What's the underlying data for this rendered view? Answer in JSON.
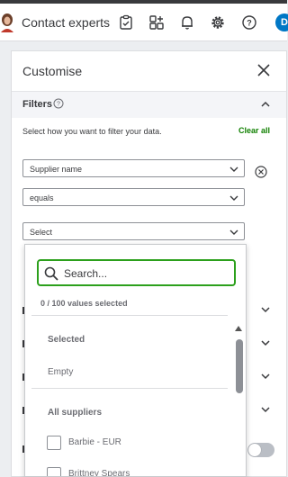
{
  "topbar": {
    "contact_label": "Contact experts",
    "avatar_initial": "D",
    "icons": [
      "user-avatar-icon",
      "checklist-icon",
      "apps-icon",
      "bell-icon",
      "gear-icon",
      "help-icon"
    ]
  },
  "panel": {
    "title": "Customise",
    "filters_section": {
      "label": "Filters",
      "instruction": "Select how you want to filter your data.",
      "clear_all": "Clear all",
      "field_select": "Supplier name",
      "operator_select": "equals",
      "value_select": "Select"
    }
  },
  "dropdown": {
    "search_placeholder": "Search...",
    "count_text": "0 / 100 values selected",
    "selected_heading": "Selected",
    "empty_text": "Empty",
    "all_heading": "All suppliers",
    "options": [
      "Barbie - EUR",
      "Brittney Spears"
    ]
  },
  "colors": {
    "accent_green": "#2ca01c",
    "clear_all_green": "#108000",
    "badge_blue": "#0077c5"
  }
}
